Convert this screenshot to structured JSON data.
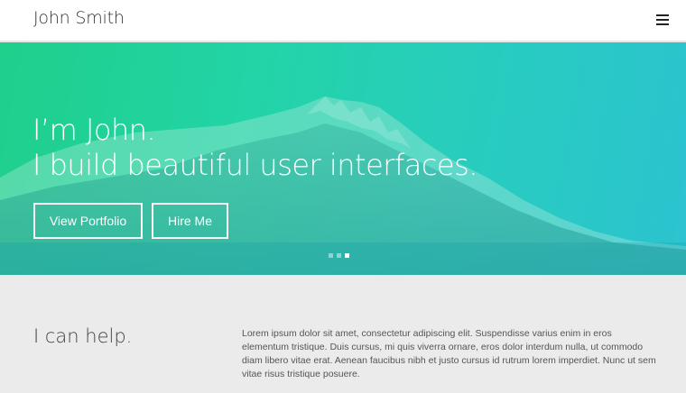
{
  "navbar": {
    "brand": "John Smith",
    "menu_icon": "hamburger-menu-icon"
  },
  "hero": {
    "title_line1": "I’m John.",
    "title_line2": "I build beautiful user interfaces.",
    "buttons": {
      "portfolio": "View Portfolio",
      "hire": "Hire Me"
    },
    "slides": {
      "count": 3,
      "active": 3
    },
    "colors": {
      "gradient_start": "#1fcf8b",
      "gradient_end": "#2bc3d0"
    }
  },
  "help": {
    "heading": "I can help.",
    "text": "Lorem ipsum dolor sit amet, consectetur adipiscing elit. Suspendisse varius enim in eros elementum tristique. Duis cursus, mi quis viverra ornare, eros dolor interdum nulla, ut commodo diam libero vitae erat. Aenean faucibus nibh et justo cursus id rutrum lorem imperdiet. Nunc ut sem vitae risus tristique posuere."
  }
}
